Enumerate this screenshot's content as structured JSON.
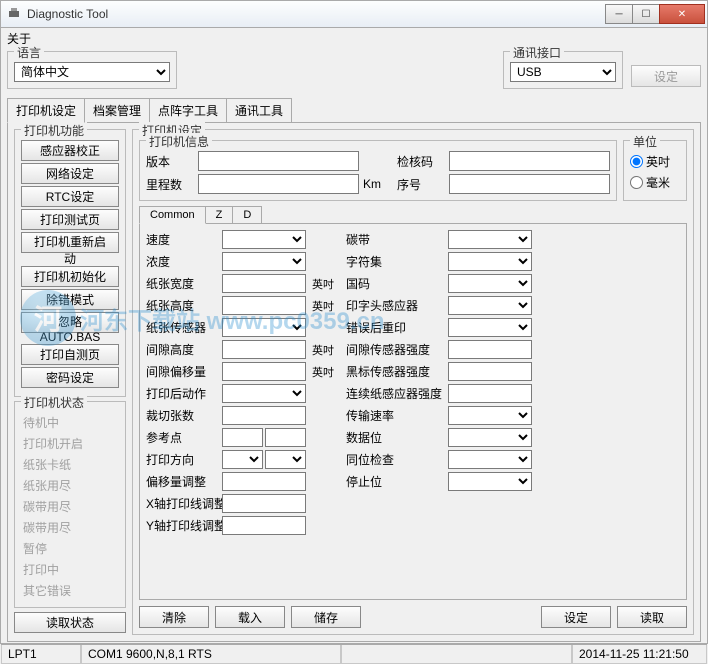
{
  "window": {
    "title": "Diagnostic Tool"
  },
  "menu": {
    "about": "关于"
  },
  "top": {
    "lang_label": "语言",
    "lang_value": "简体中文",
    "comm_label": "通讯接口",
    "comm_value": "USB",
    "set_btn": "设定"
  },
  "main_tabs": [
    "打印机设定",
    "档案管理",
    "点阵字工具",
    "通讯工具"
  ],
  "left": {
    "func_label": "打印机功能",
    "func_buttons": [
      "感应器校正",
      "网络设定",
      "RTC设定",
      "打印测试页",
      "打印机重新启动",
      "打印机初始化",
      "除错模式",
      "忽略  AUTO.BAS",
      "打印自测页",
      "密码设定"
    ],
    "status_label": "打印机状态",
    "status_items": [
      "待机中",
      "打印机开启",
      "纸张卡纸",
      "纸张用尽",
      "碳带用尽",
      "碳带用尽",
      "暂停",
      "打印中",
      "其它错误"
    ],
    "read_status_btn": "读取状态"
  },
  "printer_settings": {
    "legend": "打印机设定",
    "info_legend": "打印机信息",
    "version_label": "版本",
    "checksum_label": "检核码",
    "mileage_label": "里程数",
    "km": "Km",
    "serial_label": "序号",
    "unit_legend": "单位",
    "unit_inch": "英吋",
    "unit_mm": "毫米"
  },
  "sub_tabs": [
    "Common",
    "Z",
    "D"
  ],
  "params": {
    "left_labels": [
      "速度",
      "浓度",
      "纸张宽度",
      "纸张高度",
      "纸张传感器",
      "间隙高度",
      "间隙偏移量",
      "打印后动作",
      "裁切张数",
      "参考点",
      "打印方向",
      "偏移量调整",
      "X轴打印线调整",
      "Y轴打印线调整"
    ],
    "right_labels": [
      "碳带",
      "字符集",
      "国码",
      "印字头感应器",
      "错误后重印",
      "间隙传感器强度",
      "黑标传感器强度",
      "连续纸感应器强度",
      "传输速率",
      "数据位",
      "同位检查",
      "停止位"
    ],
    "inch": "英吋"
  },
  "bottom": {
    "clear": "清除",
    "load": "载入",
    "save": "储存",
    "set": "设定",
    "read": "读取"
  },
  "statusbar": {
    "port": "LPT1",
    "com": "COM1 9600,N,8,1 RTS",
    "datetime": "2014-11-25 11:21:50"
  },
  "watermark": "河东下载站  www.pc0359.cn"
}
